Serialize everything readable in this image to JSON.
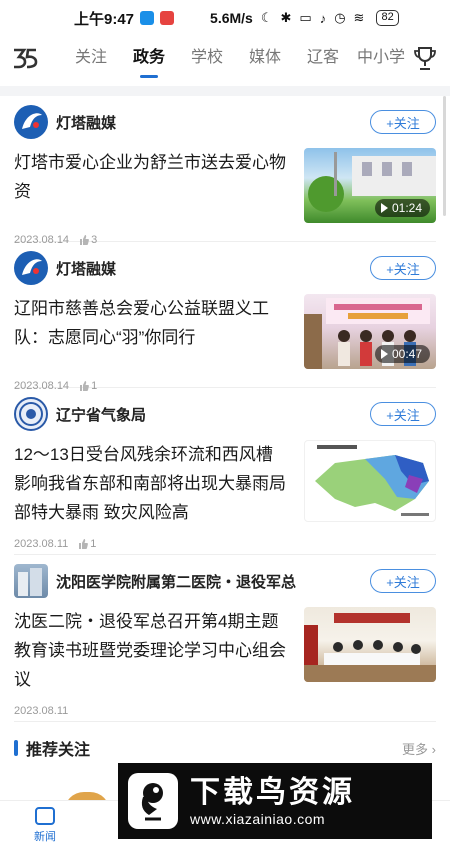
{
  "status_bar": {
    "time": "上午9:47",
    "net_speed": "5.6M/s",
    "battery": "82"
  },
  "tabs": [
    {
      "label": "关注",
      "active": false
    },
    {
      "label": "政务",
      "active": true
    },
    {
      "label": "学校",
      "active": false
    },
    {
      "label": "媒体",
      "active": false
    },
    {
      "label": "辽客",
      "active": false
    },
    {
      "label": "中小学",
      "active": false
    }
  ],
  "follow_label": "+关注",
  "articles": [
    {
      "source": "灯塔融媒",
      "headline": "灯塔市爱心企业为舒兰市送去爱心物资",
      "date": "2023.08.14",
      "likes": "3",
      "duration": "01:24",
      "avatar": "dengta-logo"
    },
    {
      "source": "灯塔融媒",
      "headline": "辽阳市慈善总会爱心公益联盟义工队：志愿同心“羽”你同行",
      "date": "2023.08.14",
      "likes": "1",
      "duration": "00:47",
      "avatar": "dengta-logo"
    },
    {
      "source": "辽宁省气象局",
      "headline": "12～13日受台风残余环流和西风槽影响我省东部和南部将出现大暴雨局部特大暴雨 致灾风险高",
      "date": "2023.08.11",
      "likes": "1",
      "avatar": "weather-seal"
    },
    {
      "source": "沈阳医学院附属第二医院・退役军总",
      "headline": "沈医二院・退役军总召开第4期主题教育读书班暨党委理论学习中心组会议",
      "date": "2023.08.11",
      "avatar": "hospital-photo"
    }
  ],
  "recommend": {
    "title": "推荐关注",
    "more": "更多"
  },
  "bottom_nav": [
    {
      "label": "新闻",
      "active": true
    },
    {
      "label": "",
      "active": false
    },
    {
      "label": "",
      "active": false
    },
    {
      "label": "",
      "active": false
    },
    {
      "label": "",
      "active": false
    }
  ],
  "watermark": {
    "main": "下载鸟资源",
    "url": "www.xiazainiao.com"
  },
  "colors": {
    "accent": "#1f6fd1",
    "follow": "#2f7bd8"
  }
}
